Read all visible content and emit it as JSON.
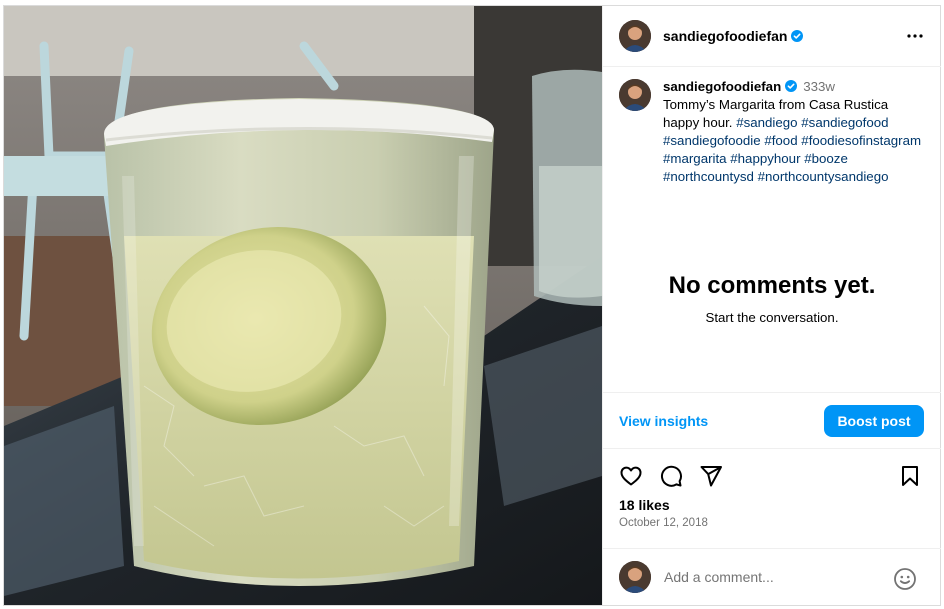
{
  "post": {
    "username": "sandiegofoodiefan",
    "verified": true,
    "photo_description_icon": "margarita-glass-photo",
    "more_icon": "more-options-icon"
  },
  "caption": {
    "username": "sandiegofoodiefan",
    "age": "333w",
    "text": "Tommy’s Margarita from Casa Rustica happy hour.",
    "hashtags": [
      "#sandiego",
      "#sandiegofood",
      "#sandiegofoodie",
      "#food",
      "#foodiesofinstagram",
      "#margarita",
      "#happyhour",
      "#booze",
      "#northcountysd",
      "#northcountysandiego"
    ]
  },
  "comments": {
    "empty_title": "No comments yet.",
    "empty_subtitle": "Start the conversation."
  },
  "insights": {
    "view_label": "View insights",
    "boost_label": "Boost post"
  },
  "actions": {
    "like_icon": "heart-icon",
    "comment_icon": "comment-icon",
    "share_icon": "share-icon",
    "save_icon": "bookmark-icon"
  },
  "stats": {
    "likes": "18 likes",
    "date": "October 12, 2018"
  },
  "add_comment": {
    "placeholder": "Add a comment...",
    "emoji_icon": "emoji-icon"
  },
  "colors": {
    "accent": "#0095f6",
    "hashtag": "#00376b",
    "muted": "#737373",
    "divider": "#efefef"
  }
}
